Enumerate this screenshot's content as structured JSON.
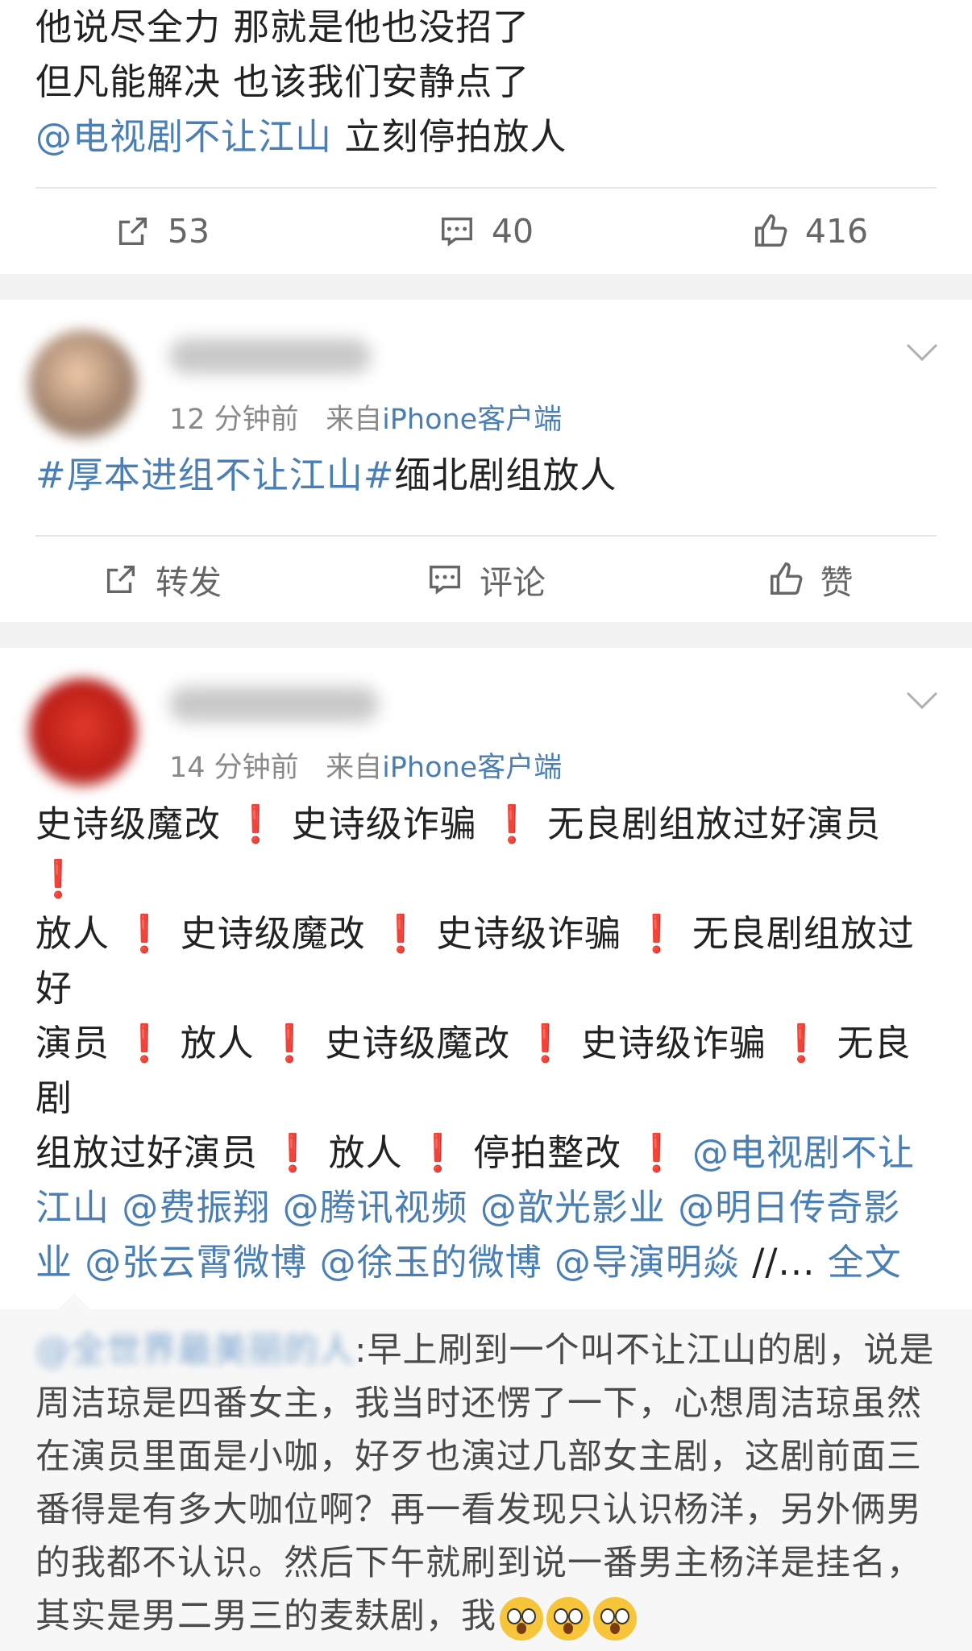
{
  "post1": {
    "lines": [
      "他说尽全力 那就是他也没招了",
      "但凡能解决 也该我们安静点了"
    ],
    "mention": "@电视剧不让江山",
    "after_mention": " 立刻停拍放人",
    "actions": {
      "repost": "53",
      "comment": "40",
      "like": "416"
    }
  },
  "post2": {
    "time": "12 分钟前",
    "from": "来自",
    "source": "iPhone客户端",
    "hashtag": "#厚本进组不让江山#",
    "text": "缅北剧组放人",
    "actions": {
      "repost": "转发",
      "comment": "评论",
      "like": "赞"
    }
  },
  "post3": {
    "time": "14 分钟前",
    "from": "来自",
    "source": "iPhone客户端",
    "b1": "史诗级魔改 ",
    "b2": " 史诗级诈骗 ",
    "b3": " 无良剧组放过好演员 ",
    "b4": "放人 ",
    "b5": " 史诗级魔改 ",
    "b6": " 史诗级诈骗 ",
    "b7": " 无良剧组放过好",
    "b8": "演员 ",
    "b9": " 放人 ",
    "b10": " 史诗级魔改 ",
    "b11": " 史诗级诈骗 ",
    "b12": " 无良剧",
    "b13": "组放过好演员 ",
    "b14": " 放人 ",
    "b15": " 停拍整改 ",
    "mentions": "@电视剧不让江山 @费振翔 @腾讯视频 @歆光影业 @明日传奇影业 @张云霄微博 @徐玉的微博 @导演明焱",
    "ellipsis": " //... ",
    "full": "全文",
    "bang": "❗"
  },
  "quote": {
    "user": "@全世界最美丽的人",
    "text": ":早上刷到一个叫不让江山的剧，说是周洁琼是四番女主，我当时还愣了一下，心想周洁琼虽然在演员里面是小咖，好歹也演过几部女主剧，这剧前面三番得是有多大咖位啊？再一看发现只认识杨洋，另外俩男的我都不认识。然后下午就刷到说一番男主杨洋是挂名，其实是男二男三的麦麸剧，我"
  }
}
